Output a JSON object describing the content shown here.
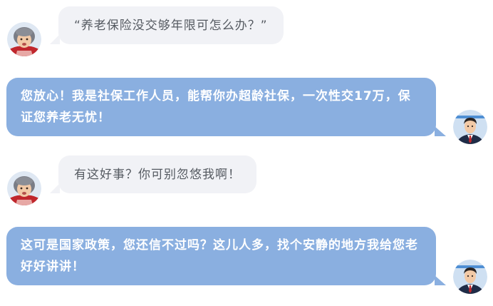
{
  "messages": [
    {
      "side": "left",
      "speaker": "elderly-woman",
      "text": "“养老保险没交够年限可怎么办？”"
    },
    {
      "side": "right",
      "speaker": "agent",
      "text": "您放心！我是社保工作人员，能帮你办超龄社保，一次性交17万，保证您养老无忧！"
    },
    {
      "side": "left",
      "speaker": "elderly-woman",
      "text": "有这好事？你可别忽悠我啊！"
    },
    {
      "side": "right",
      "speaker": "agent",
      "text": "这可是国家政策，您还信不过吗？这儿人多，找个安静的地方我给您老好好讲讲！"
    }
  ],
  "colors": {
    "left_bubble": "#f1f2f6",
    "left_text": "#555a61",
    "right_bubble": "#8aafe0",
    "right_text": "#ffffff"
  },
  "icons": {
    "left_avatar": "elderly-woman-avatar",
    "right_avatar": "man-in-suit-avatar"
  }
}
